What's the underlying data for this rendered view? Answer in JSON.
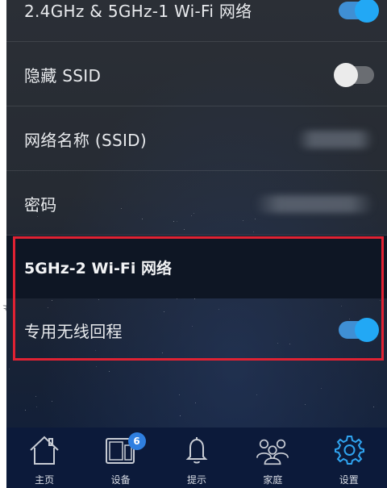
{
  "settings": {
    "rows": [
      {
        "label": "2.4GHz & 5GHz-1 Wi-Fi 网络",
        "toggle": "on"
      },
      {
        "label": "隐藏 SSID",
        "toggle": "off"
      },
      {
        "label": "网络名称 (SSID)",
        "value": "(blurred)"
      },
      {
        "label": "密码",
        "value": "(blurred)"
      }
    ],
    "section_title": "5GHz-2 Wi-Fi 网络",
    "backhaul": {
      "label": "专用无线回程",
      "toggle": "on"
    }
  },
  "nav": {
    "items": [
      {
        "label": "主页",
        "icon": "home-icon"
      },
      {
        "label": "设备",
        "icon": "devices-icon",
        "badge": "6"
      },
      {
        "label": "提示",
        "icon": "bell-icon"
      },
      {
        "label": "家庭",
        "icon": "family-icon"
      },
      {
        "label": "设置",
        "icon": "gear-icon",
        "active": true
      }
    ]
  },
  "colors": {
    "toggle_on": "#22a8f5",
    "highlight_border": "#e02233",
    "nav_active": "#2fa4f0",
    "nav_inactive": "#c8ccd4"
  }
}
